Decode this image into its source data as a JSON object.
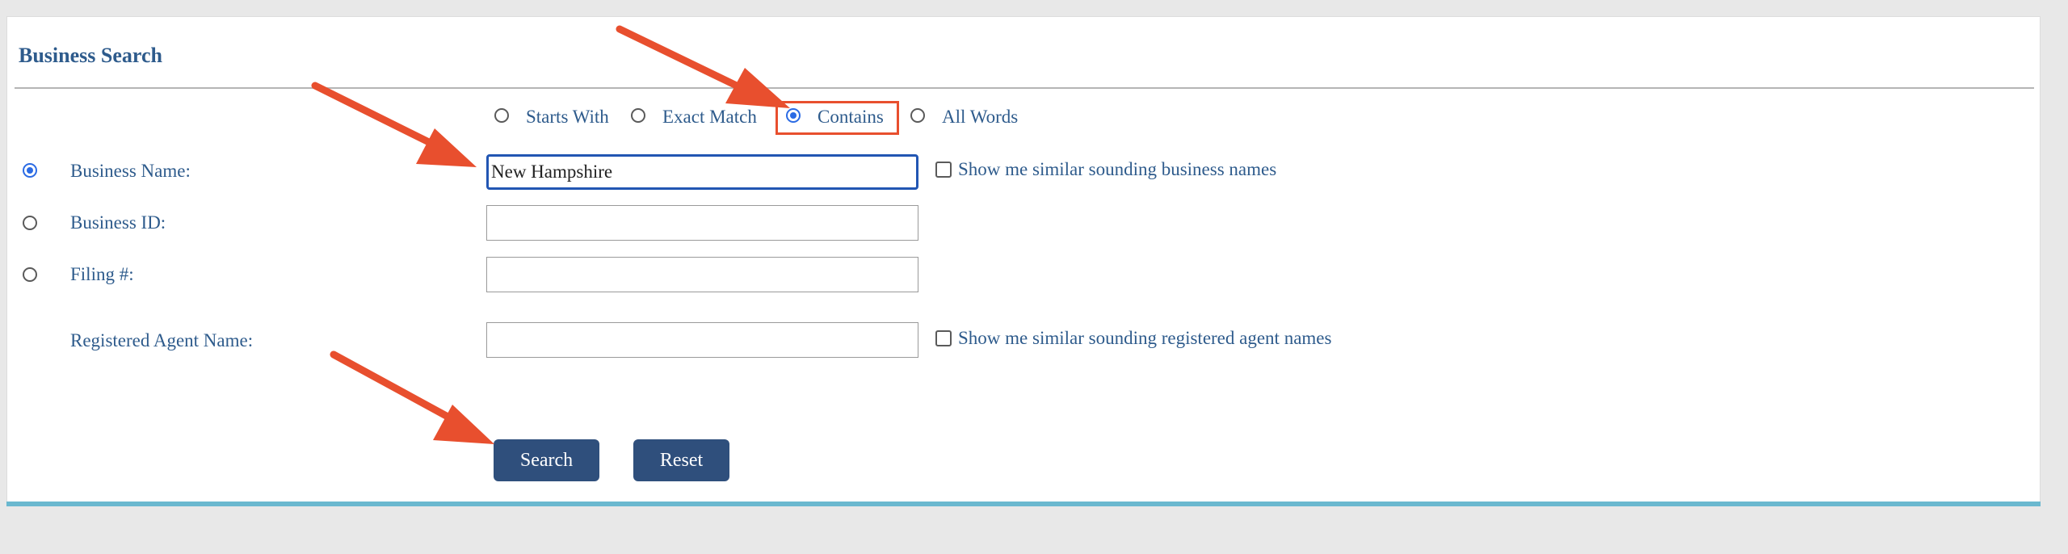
{
  "form": {
    "title": "Business Search",
    "match_options": [
      {
        "label": "Starts With",
        "checked": false
      },
      {
        "label": "Exact Match",
        "checked": false
      },
      {
        "label": "Contains",
        "checked": true
      },
      {
        "label": "All Words",
        "checked": false
      }
    ],
    "fields": {
      "business_name": {
        "label": "Business Name:",
        "value": "New Hampshire",
        "selected": true
      },
      "business_id": {
        "label": "Business ID:",
        "value": "",
        "selected": false
      },
      "filing_number": {
        "label": "Filing #:",
        "value": "",
        "selected": false
      },
      "registered_agent": {
        "label": "Registered Agent Name:",
        "value": ""
      }
    },
    "similar_business": "Show me similar sounding business names",
    "similar_agent": "Show me similar sounding registered agent names",
    "search_label": "Search",
    "reset_label": "Reset"
  },
  "colors": {
    "accent": "#2e5b8c",
    "button": "#2f4f7c",
    "annotation": "#e84f2e",
    "footer_bar": "#6ab8cf"
  }
}
